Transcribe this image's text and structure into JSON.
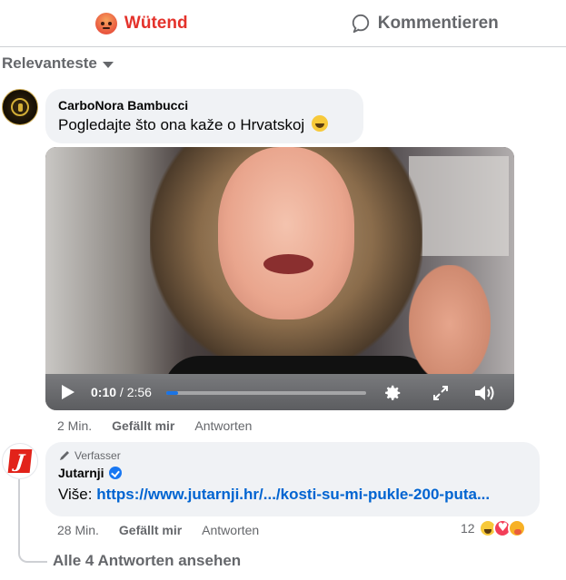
{
  "actions": {
    "angry_label": "Wütend",
    "comment_label": "Kommentieren"
  },
  "sort": {
    "label": "Relevanteste"
  },
  "comment1": {
    "author": "CarboNora Bambucci",
    "text": "Pogledajte što ona kaže o Hrvatskoj",
    "emoji": "grinning-face",
    "video": {
      "current_time": "0:10",
      "separator": " / ",
      "duration": "2:56",
      "progress_fraction": 0.057
    },
    "time": "2 Min.",
    "like_label": "Gefällt mir",
    "reply_label": "Antworten"
  },
  "comment2": {
    "badge": "Verfasser",
    "author": "Jutarnji",
    "verified": true,
    "text_prefix": "Više: ",
    "link": "https://www.jutarnji.hr/.../kosti-su-mi-pukle-200-puta...",
    "time": "28 Min.",
    "like_label": "Gefällt mir",
    "reply_label": "Antworten",
    "reaction_count": "12",
    "reactions": [
      "haha",
      "love",
      "care"
    ]
  },
  "view_replies": {
    "label": "Alle 4 Antworten ansehen"
  },
  "colors": {
    "angry": "#e4322b",
    "link": "#0064d1",
    "muted": "#65676b",
    "bubble": "#f0f2f5",
    "progress": "#1b74e4"
  }
}
